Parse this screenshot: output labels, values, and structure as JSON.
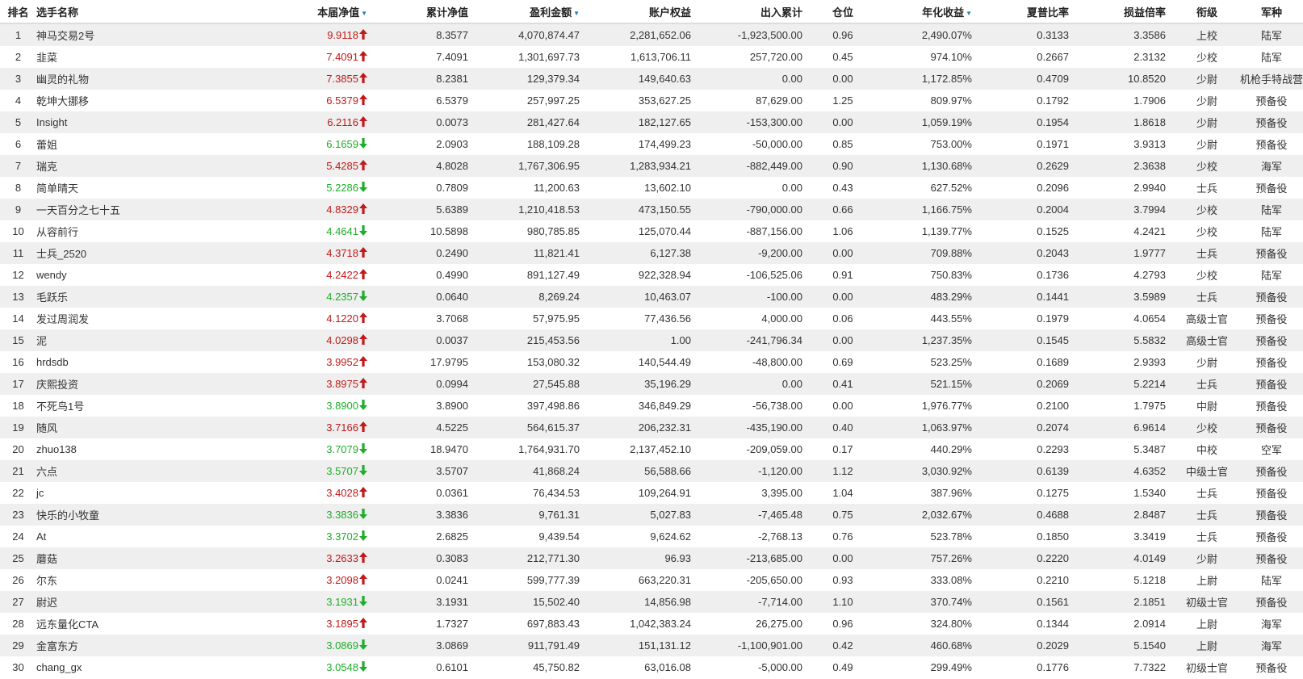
{
  "headers": {
    "rank": "排名",
    "name": "选手名称",
    "nav": "本届净值",
    "cum_nav": "累计净值",
    "profit": "盈利金额",
    "equity": "账户权益",
    "io": "出入累计",
    "position": "仓位",
    "annual": "年化收益",
    "sharpe": "夏普比率",
    "ratio": "损益倍率",
    "rank_title": "衔级",
    "branch": "军种"
  },
  "sorted_columns": [
    "nav",
    "profit",
    "annual"
  ],
  "colors": {
    "up": "#c21a1a",
    "down": "#1fae2a",
    "sort_icon": "#2a7ab8",
    "row_alt": "#efefef"
  },
  "icons": {
    "up": "arrow-up-icon",
    "down": "arrow-down-icon",
    "sort": "sort-desc-icon"
  },
  "rows": [
    {
      "rank": "1",
      "name": "神马交易2号",
      "nav": "9.9118",
      "trend": "up",
      "cum_nav": "8.3577",
      "profit": "4,070,874.47",
      "equity": "2,281,652.06",
      "io": "-1,923,500.00",
      "position": "0.96",
      "annual": "2,490.07%",
      "sharpe": "0.3133",
      "ratio": "3.3586",
      "rank_title": "上校",
      "branch": "陆军"
    },
    {
      "rank": "2",
      "name": "韭菜",
      "nav": "7.4091",
      "trend": "up",
      "cum_nav": "7.4091",
      "profit": "1,301,697.73",
      "equity": "1,613,706.11",
      "io": "257,720.00",
      "position": "0.45",
      "annual": "974.10%",
      "sharpe": "0.2667",
      "ratio": "2.3132",
      "rank_title": "少校",
      "branch": "陆军"
    },
    {
      "rank": "3",
      "name": "幽灵的礼物",
      "nav": "7.3855",
      "trend": "up",
      "cum_nav": "8.2381",
      "profit": "129,379.34",
      "equity": "149,640.63",
      "io": "0.00",
      "position": "0.00",
      "annual": "1,172.85%",
      "sharpe": "0.4709",
      "ratio": "10.8520",
      "rank_title": "少尉",
      "branch": "机枪手特战营"
    },
    {
      "rank": "4",
      "name": "乾坤大挪移",
      "nav": "6.5379",
      "trend": "up",
      "cum_nav": "6.5379",
      "profit": "257,997.25",
      "equity": "353,627.25",
      "io": "87,629.00",
      "position": "1.25",
      "annual": "809.97%",
      "sharpe": "0.1792",
      "ratio": "1.7906",
      "rank_title": "少尉",
      "branch": "预备役"
    },
    {
      "rank": "5",
      "name": "Insight",
      "nav": "6.2116",
      "trend": "up",
      "cum_nav": "0.0073",
      "profit": "281,427.64",
      "equity": "182,127.65",
      "io": "-153,300.00",
      "position": "0.00",
      "annual": "1,059.19%",
      "sharpe": "0.1954",
      "ratio": "1.8618",
      "rank_title": "少尉",
      "branch": "预备役"
    },
    {
      "rank": "6",
      "name": "蕾姐",
      "nav": "6.1659",
      "trend": "down",
      "cum_nav": "2.0903",
      "profit": "188,109.28",
      "equity": "174,499.23",
      "io": "-50,000.00",
      "position": "0.85",
      "annual": "753.00%",
      "sharpe": "0.1971",
      "ratio": "3.9313",
      "rank_title": "少尉",
      "branch": "预备役"
    },
    {
      "rank": "7",
      "name": "瑞克",
      "nav": "5.4285",
      "trend": "up",
      "cum_nav": "4.8028",
      "profit": "1,767,306.95",
      "equity": "1,283,934.21",
      "io": "-882,449.00",
      "position": "0.90",
      "annual": "1,130.68%",
      "sharpe": "0.2629",
      "ratio": "2.3638",
      "rank_title": "少校",
      "branch": "海军"
    },
    {
      "rank": "8",
      "name": "简单晴天",
      "nav": "5.2286",
      "trend": "down",
      "cum_nav": "0.7809",
      "profit": "11,200.63",
      "equity": "13,602.10",
      "io": "0.00",
      "position": "0.43",
      "annual": "627.52%",
      "sharpe": "0.2096",
      "ratio": "2.9940",
      "rank_title": "士兵",
      "branch": "预备役"
    },
    {
      "rank": "9",
      "name": "一天百分之七十五",
      "nav": "4.8329",
      "trend": "up",
      "cum_nav": "5.6389",
      "profit": "1,210,418.53",
      "equity": "473,150.55",
      "io": "-790,000.00",
      "position": "0.66",
      "annual": "1,166.75%",
      "sharpe": "0.2004",
      "ratio": "3.7994",
      "rank_title": "少校",
      "branch": "陆军"
    },
    {
      "rank": "10",
      "name": "从容前行",
      "nav": "4.4641",
      "trend": "down",
      "cum_nav": "10.5898",
      "profit": "980,785.85",
      "equity": "125,070.44",
      "io": "-887,156.00",
      "position": "1.06",
      "annual": "1,139.77%",
      "sharpe": "0.1525",
      "ratio": "4.2421",
      "rank_title": "少校",
      "branch": "陆军"
    },
    {
      "rank": "11",
      "name": "士兵_2520",
      "nav": "4.3718",
      "trend": "up",
      "cum_nav": "0.2490",
      "profit": "11,821.41",
      "equity": "6,127.38",
      "io": "-9,200.00",
      "position": "0.00",
      "annual": "709.88%",
      "sharpe": "0.2043",
      "ratio": "1.9777",
      "rank_title": "士兵",
      "branch": "预备役"
    },
    {
      "rank": "12",
      "name": "wendy",
      "nav": "4.2422",
      "trend": "up",
      "cum_nav": "0.4990",
      "profit": "891,127.49",
      "equity": "922,328.94",
      "io": "-106,525.06",
      "position": "0.91",
      "annual": "750.83%",
      "sharpe": "0.1736",
      "ratio": "4.2793",
      "rank_title": "少校",
      "branch": "陆军"
    },
    {
      "rank": "13",
      "name": "毛跃乐",
      "nav": "4.2357",
      "trend": "down",
      "cum_nav": "0.0640",
      "profit": "8,269.24",
      "equity": "10,463.07",
      "io": "-100.00",
      "position": "0.00",
      "annual": "483.29%",
      "sharpe": "0.1441",
      "ratio": "3.5989",
      "rank_title": "士兵",
      "branch": "预备役"
    },
    {
      "rank": "14",
      "name": "发过周润发",
      "nav": "4.1220",
      "trend": "up",
      "cum_nav": "3.7068",
      "profit": "57,975.95",
      "equity": "77,436.56",
      "io": "4,000.00",
      "position": "0.06",
      "annual": "443.55%",
      "sharpe": "0.1979",
      "ratio": "4.0654",
      "rank_title": "高级士官",
      "branch": "预备役"
    },
    {
      "rank": "15",
      "name": "泥",
      "nav": "4.0298",
      "trend": "up",
      "cum_nav": "0.0037",
      "profit": "215,453.56",
      "equity": "1.00",
      "io": "-241,796.34",
      "position": "0.00",
      "annual": "1,237.35%",
      "sharpe": "0.1545",
      "ratio": "5.5832",
      "rank_title": "高级士官",
      "branch": "预备役"
    },
    {
      "rank": "16",
      "name": "hrdsdb",
      "nav": "3.9952",
      "trend": "up",
      "cum_nav": "17.9795",
      "profit": "153,080.32",
      "equity": "140,544.49",
      "io": "-48,800.00",
      "position": "0.69",
      "annual": "523.25%",
      "sharpe": "0.1689",
      "ratio": "2.9393",
      "rank_title": "少尉",
      "branch": "预备役"
    },
    {
      "rank": "17",
      "name": "庆熙投资",
      "nav": "3.8975",
      "trend": "up",
      "cum_nav": "0.0994",
      "profit": "27,545.88",
      "equity": "35,196.29",
      "io": "0.00",
      "position": "0.41",
      "annual": "521.15%",
      "sharpe": "0.2069",
      "ratio": "5.2214",
      "rank_title": "士兵",
      "branch": "预备役"
    },
    {
      "rank": "18",
      "name": "不死鸟1号",
      "nav": "3.8900",
      "trend": "down",
      "cum_nav": "3.8900",
      "profit": "397,498.86",
      "equity": "346,849.29",
      "io": "-56,738.00",
      "position": "0.00",
      "annual": "1,976.77%",
      "sharpe": "0.2100",
      "ratio": "1.7975",
      "rank_title": "中尉",
      "branch": "预备役"
    },
    {
      "rank": "19",
      "name": "随风",
      "nav": "3.7166",
      "trend": "up",
      "cum_nav": "4.5225",
      "profit": "564,615.37",
      "equity": "206,232.31",
      "io": "-435,190.00",
      "position": "0.40",
      "annual": "1,063.97%",
      "sharpe": "0.2074",
      "ratio": "6.9614",
      "rank_title": "少校",
      "branch": "预备役"
    },
    {
      "rank": "20",
      "name": "zhuo138",
      "nav": "3.7079",
      "trend": "down",
      "cum_nav": "18.9470",
      "profit": "1,764,931.70",
      "equity": "2,137,452.10",
      "io": "-209,059.00",
      "position": "0.17",
      "annual": "440.29%",
      "sharpe": "0.2293",
      "ratio": "5.3487",
      "rank_title": "中校",
      "branch": "空军"
    },
    {
      "rank": "21",
      "name": "六点",
      "nav": "3.5707",
      "trend": "down",
      "cum_nav": "3.5707",
      "profit": "41,868.24",
      "equity": "56,588.66",
      "io": "-1,120.00",
      "position": "1.12",
      "annual": "3,030.92%",
      "sharpe": "0.6139",
      "ratio": "4.6352",
      "rank_title": "中级士官",
      "branch": "预备役"
    },
    {
      "rank": "22",
      "name": "jc",
      "nav": "3.4028",
      "trend": "up",
      "cum_nav": "0.0361",
      "profit": "76,434.53",
      "equity": "109,264.91",
      "io": "3,395.00",
      "position": "1.04",
      "annual": "387.96%",
      "sharpe": "0.1275",
      "ratio": "1.5340",
      "rank_title": "士兵",
      "branch": "预备役"
    },
    {
      "rank": "23",
      "name": "快乐的小牧童",
      "nav": "3.3836",
      "trend": "down",
      "cum_nav": "3.3836",
      "profit": "9,761.31",
      "equity": "5,027.83",
      "io": "-7,465.48",
      "position": "0.75",
      "annual": "2,032.67%",
      "sharpe": "0.4688",
      "ratio": "2.8487",
      "rank_title": "士兵",
      "branch": "预备役"
    },
    {
      "rank": "24",
      "name": "At",
      "nav": "3.3702",
      "trend": "down",
      "cum_nav": "2.6825",
      "profit": "9,439.54",
      "equity": "9,624.62",
      "io": "-2,768.13",
      "position": "0.76",
      "annual": "523.78%",
      "sharpe": "0.1850",
      "ratio": "3.3419",
      "rank_title": "士兵",
      "branch": "预备役"
    },
    {
      "rank": "25",
      "name": "蘑菇",
      "nav": "3.2633",
      "trend": "up",
      "cum_nav": "0.3083",
      "profit": "212,771.30",
      "equity": "96.93",
      "io": "-213,685.00",
      "position": "0.00",
      "annual": "757.26%",
      "sharpe": "0.2220",
      "ratio": "4.0149",
      "rank_title": "少尉",
      "branch": "预备役"
    },
    {
      "rank": "26",
      "name": "尔东",
      "nav": "3.2098",
      "trend": "up",
      "cum_nav": "0.0241",
      "profit": "599,777.39",
      "equity": "663,220.31",
      "io": "-205,650.00",
      "position": "0.93",
      "annual": "333.08%",
      "sharpe": "0.2210",
      "ratio": "5.1218",
      "rank_title": "上尉",
      "branch": "陆军"
    },
    {
      "rank": "27",
      "name": "尉迟",
      "nav": "3.1931",
      "trend": "down",
      "cum_nav": "3.1931",
      "profit": "15,502.40",
      "equity": "14,856.98",
      "io": "-7,714.00",
      "position": "1.10",
      "annual": "370.74%",
      "sharpe": "0.1561",
      "ratio": "2.1851",
      "rank_title": "初级士官",
      "branch": "预备役"
    },
    {
      "rank": "28",
      "name": "远东量化CTA",
      "nav": "3.1895",
      "trend": "up",
      "cum_nav": "1.7327",
      "profit": "697,883.43",
      "equity": "1,042,383.24",
      "io": "26,275.00",
      "position": "0.96",
      "annual": "324.80%",
      "sharpe": "0.1344",
      "ratio": "2.0914",
      "rank_title": "上尉",
      "branch": "海军"
    },
    {
      "rank": "29",
      "name": "金富东方",
      "nav": "3.0869",
      "trend": "down",
      "cum_nav": "3.0869",
      "profit": "911,791.49",
      "equity": "151,131.12",
      "io": "-1,100,901.00",
      "position": "0.42",
      "annual": "460.68%",
      "sharpe": "0.2029",
      "ratio": "5.1540",
      "rank_title": "上尉",
      "branch": "海军"
    },
    {
      "rank": "30",
      "name": "chang_gx",
      "nav": "3.0548",
      "trend": "down",
      "cum_nav": "0.6101",
      "profit": "45,750.82",
      "equity": "63,016.08",
      "io": "-5,000.00",
      "position": "0.49",
      "annual": "299.49%",
      "sharpe": "0.1776",
      "ratio": "7.7322",
      "rank_title": "初级士官",
      "branch": "预备役"
    }
  ]
}
